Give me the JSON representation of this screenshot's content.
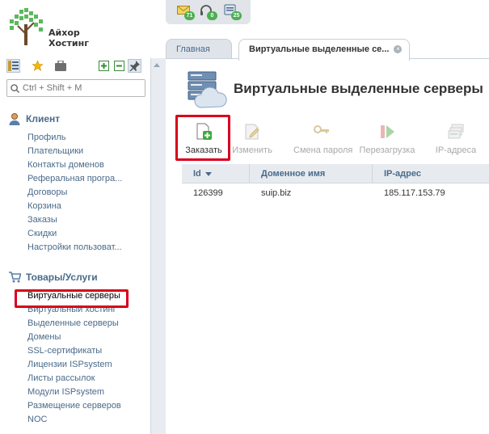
{
  "brand": {
    "line1": "Айхор",
    "line2": "Хостинг"
  },
  "notifications": [
    {
      "icon": "envelope-icon",
      "count": "71"
    },
    {
      "icon": "headset-icon",
      "count": "0"
    },
    {
      "icon": "monitor-icon",
      "count": "25"
    }
  ],
  "search": {
    "placeholder": "Ctrl + Shift + M"
  },
  "sidebar": {
    "client": {
      "title": "Клиент",
      "items": [
        "Профиль",
        "Плательщики",
        "Контакты доменов",
        "Реферальная програ...",
        "Договоры",
        "Корзина",
        "Заказы",
        "Скидки",
        "Настройки пользоват..."
      ]
    },
    "goods": {
      "title": "Товары/Услуги",
      "items": [
        "Виртуальные серверы",
        "Виртуальный хостинг",
        "Выделенные серверы",
        "Домены",
        "SSL-сертификаты",
        "Лицензии ISPsystem",
        "Листы рассылок",
        "Модули ISPsystem",
        "Размещение серверов",
        "NOC"
      ],
      "selected_index": 0
    }
  },
  "tabs": [
    {
      "label": "Главная",
      "active": false
    },
    {
      "label": "Виртуальные выделенные се...",
      "active": true
    }
  ],
  "page": {
    "title": "Виртуальные выделенные серверы"
  },
  "actions": [
    {
      "label": "Заказать",
      "icon": "add-document-icon",
      "enabled": true
    },
    {
      "label": "Изменить",
      "icon": "edit-icon",
      "enabled": false
    },
    {
      "label": "Смена пароля",
      "icon": "key-icon",
      "enabled": false
    },
    {
      "label": "Перезагрузка",
      "icon": "restart-icon",
      "enabled": false
    },
    {
      "label": "IP-адреса",
      "icon": "ip-stack-icon",
      "enabled": false
    }
  ],
  "table": {
    "columns": [
      "Id",
      "Доменное имя",
      "IP-адрес"
    ],
    "sort_column": "Id",
    "rows": [
      {
        "id": "126399",
        "domain": "suip.biz",
        "ip": "185.117.153.79"
      }
    ]
  },
  "colors": {
    "accent": "#4a6a8a",
    "highlight": "#d9001b",
    "badge": "#4caf50"
  }
}
